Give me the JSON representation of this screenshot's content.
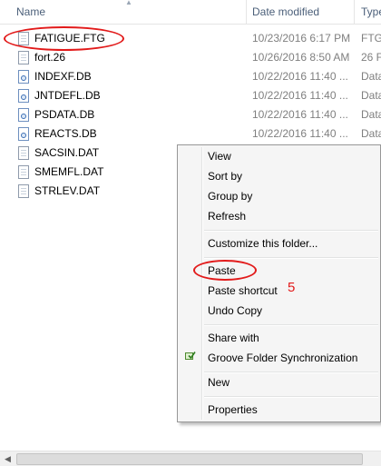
{
  "columns": {
    "name": "Name",
    "date_modified": "Date modified",
    "type": "Type"
  },
  "files": [
    {
      "name": "FATIGUE.FTG",
      "date": "10/23/2016 6:17 PM",
      "type": "FTG",
      "icon": "document-icon"
    },
    {
      "name": "fort.26",
      "date": "10/26/2016 8:50 AM",
      "type": "26 F",
      "icon": "document-icon"
    },
    {
      "name": "INDEXF.DB",
      "date": "10/22/2016 11:40 ...",
      "type": "Data",
      "icon": "database-icon"
    },
    {
      "name": "JNTDEFL.DB",
      "date": "10/22/2016 11:40 ...",
      "type": "Data",
      "icon": "database-icon"
    },
    {
      "name": "PSDATA.DB",
      "date": "10/22/2016 11:40 ...",
      "type": "Data",
      "icon": "database-icon"
    },
    {
      "name": "REACTS.DB",
      "date": "10/22/2016 11:40 ...",
      "type": "Data",
      "icon": "database-icon"
    },
    {
      "name": "SACSIN.DAT",
      "date": "",
      "type": "",
      "icon": "document-icon"
    },
    {
      "name": "SMEMFL.DAT",
      "date": "",
      "type": "",
      "icon": "document-icon"
    },
    {
      "name": "STRLEV.DAT",
      "date": "",
      "type": "",
      "icon": "document-icon"
    }
  ],
  "context_menu": {
    "view": "View",
    "sort_by": "Sort by",
    "group_by": "Group by",
    "refresh": "Refresh",
    "customize": "Customize this folder...",
    "paste": "Paste",
    "paste_shortcut": "Paste shortcut",
    "undo_copy": "Undo Copy",
    "share_with": "Share with",
    "groove_sync": "Groove Folder Synchronization",
    "new": "New",
    "properties": "Properties"
  },
  "annotation": {
    "step_number": "5",
    "color": "#e21a1a"
  }
}
